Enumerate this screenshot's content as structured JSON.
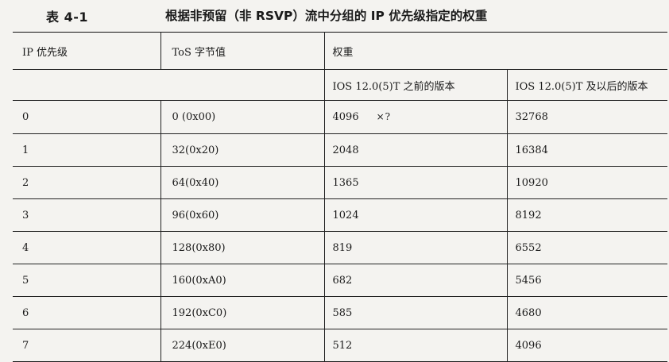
{
  "caption": {
    "number": "表 4-1",
    "title": "根据非预留（非 RSVP）流中分组的 IP 优先级指定的权重"
  },
  "table": {
    "headers": {
      "ip_precedence": "IP 优先级",
      "tos_byte": "ToS  字节值",
      "weight": "权重",
      "before": "IOS 12.0(5)T 之前的版本",
      "after": "IOS 12.0(5)T 及以后的版本"
    },
    "rows": [
      {
        "ip": "0",
        "tos": "0 (0x00)",
        "before": "4096",
        "after": "32768",
        "note": "×?"
      },
      {
        "ip": "1",
        "tos": "32(0x20)",
        "before": "2048",
        "after": "16384"
      },
      {
        "ip": "2",
        "tos": "64(0x40)",
        "before": "1365",
        "after": "10920"
      },
      {
        "ip": "3",
        "tos": "96(0x60)",
        "before": "1024",
        "after": "8192"
      },
      {
        "ip": "4",
        "tos": "128(0x80)",
        "before": "819",
        "after": "6552"
      },
      {
        "ip": "5",
        "tos": "160(0xA0)",
        "before": "682",
        "after": "5456"
      },
      {
        "ip": "6",
        "tos": "192(0xC0)",
        "before": "585",
        "after": "4680"
      },
      {
        "ip": "7",
        "tos": "224(0xE0)",
        "before": "512",
        "after": "4096"
      }
    ]
  }
}
